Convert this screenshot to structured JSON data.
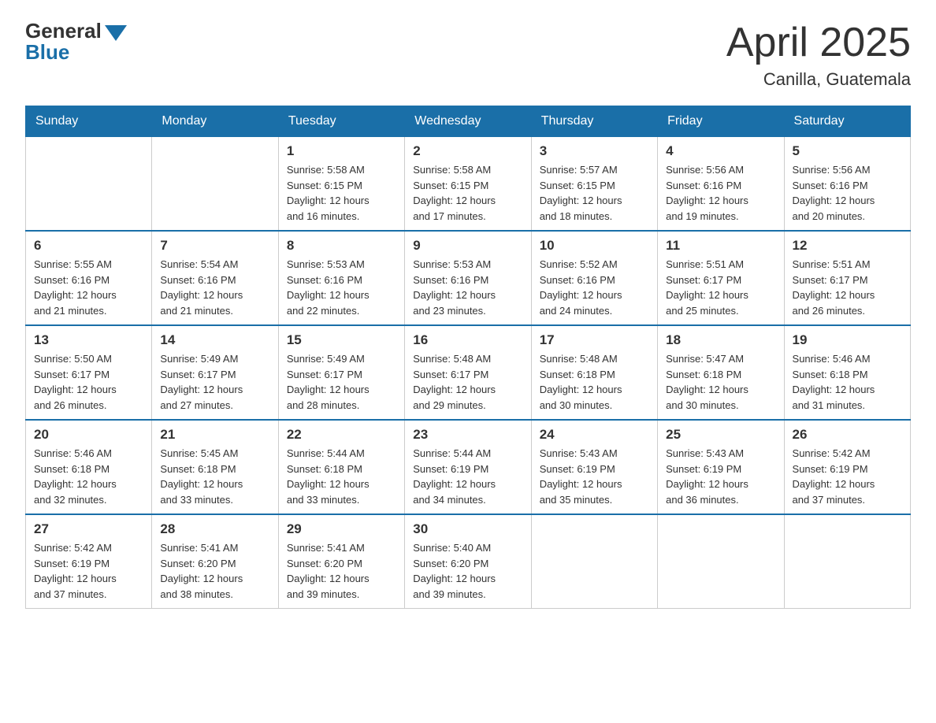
{
  "header": {
    "logo_general": "General",
    "logo_blue": "Blue",
    "month": "April 2025",
    "location": "Canilla, Guatemala"
  },
  "weekdays": [
    "Sunday",
    "Monday",
    "Tuesday",
    "Wednesday",
    "Thursday",
    "Friday",
    "Saturday"
  ],
  "weeks": [
    [
      {
        "day": "",
        "info": ""
      },
      {
        "day": "",
        "info": ""
      },
      {
        "day": "1",
        "info": "Sunrise: 5:58 AM\nSunset: 6:15 PM\nDaylight: 12 hours\nand 16 minutes."
      },
      {
        "day": "2",
        "info": "Sunrise: 5:58 AM\nSunset: 6:15 PM\nDaylight: 12 hours\nand 17 minutes."
      },
      {
        "day": "3",
        "info": "Sunrise: 5:57 AM\nSunset: 6:15 PM\nDaylight: 12 hours\nand 18 minutes."
      },
      {
        "day": "4",
        "info": "Sunrise: 5:56 AM\nSunset: 6:16 PM\nDaylight: 12 hours\nand 19 minutes."
      },
      {
        "day": "5",
        "info": "Sunrise: 5:56 AM\nSunset: 6:16 PM\nDaylight: 12 hours\nand 20 minutes."
      }
    ],
    [
      {
        "day": "6",
        "info": "Sunrise: 5:55 AM\nSunset: 6:16 PM\nDaylight: 12 hours\nand 21 minutes."
      },
      {
        "day": "7",
        "info": "Sunrise: 5:54 AM\nSunset: 6:16 PM\nDaylight: 12 hours\nand 21 minutes."
      },
      {
        "day": "8",
        "info": "Sunrise: 5:53 AM\nSunset: 6:16 PM\nDaylight: 12 hours\nand 22 minutes."
      },
      {
        "day": "9",
        "info": "Sunrise: 5:53 AM\nSunset: 6:16 PM\nDaylight: 12 hours\nand 23 minutes."
      },
      {
        "day": "10",
        "info": "Sunrise: 5:52 AM\nSunset: 6:16 PM\nDaylight: 12 hours\nand 24 minutes."
      },
      {
        "day": "11",
        "info": "Sunrise: 5:51 AM\nSunset: 6:17 PM\nDaylight: 12 hours\nand 25 minutes."
      },
      {
        "day": "12",
        "info": "Sunrise: 5:51 AM\nSunset: 6:17 PM\nDaylight: 12 hours\nand 26 minutes."
      }
    ],
    [
      {
        "day": "13",
        "info": "Sunrise: 5:50 AM\nSunset: 6:17 PM\nDaylight: 12 hours\nand 26 minutes."
      },
      {
        "day": "14",
        "info": "Sunrise: 5:49 AM\nSunset: 6:17 PM\nDaylight: 12 hours\nand 27 minutes."
      },
      {
        "day": "15",
        "info": "Sunrise: 5:49 AM\nSunset: 6:17 PM\nDaylight: 12 hours\nand 28 minutes."
      },
      {
        "day": "16",
        "info": "Sunrise: 5:48 AM\nSunset: 6:17 PM\nDaylight: 12 hours\nand 29 minutes."
      },
      {
        "day": "17",
        "info": "Sunrise: 5:48 AM\nSunset: 6:18 PM\nDaylight: 12 hours\nand 30 minutes."
      },
      {
        "day": "18",
        "info": "Sunrise: 5:47 AM\nSunset: 6:18 PM\nDaylight: 12 hours\nand 30 minutes."
      },
      {
        "day": "19",
        "info": "Sunrise: 5:46 AM\nSunset: 6:18 PM\nDaylight: 12 hours\nand 31 minutes."
      }
    ],
    [
      {
        "day": "20",
        "info": "Sunrise: 5:46 AM\nSunset: 6:18 PM\nDaylight: 12 hours\nand 32 minutes."
      },
      {
        "day": "21",
        "info": "Sunrise: 5:45 AM\nSunset: 6:18 PM\nDaylight: 12 hours\nand 33 minutes."
      },
      {
        "day": "22",
        "info": "Sunrise: 5:44 AM\nSunset: 6:18 PM\nDaylight: 12 hours\nand 33 minutes."
      },
      {
        "day": "23",
        "info": "Sunrise: 5:44 AM\nSunset: 6:19 PM\nDaylight: 12 hours\nand 34 minutes."
      },
      {
        "day": "24",
        "info": "Sunrise: 5:43 AM\nSunset: 6:19 PM\nDaylight: 12 hours\nand 35 minutes."
      },
      {
        "day": "25",
        "info": "Sunrise: 5:43 AM\nSunset: 6:19 PM\nDaylight: 12 hours\nand 36 minutes."
      },
      {
        "day": "26",
        "info": "Sunrise: 5:42 AM\nSunset: 6:19 PM\nDaylight: 12 hours\nand 37 minutes."
      }
    ],
    [
      {
        "day": "27",
        "info": "Sunrise: 5:42 AM\nSunset: 6:19 PM\nDaylight: 12 hours\nand 37 minutes."
      },
      {
        "day": "28",
        "info": "Sunrise: 5:41 AM\nSunset: 6:20 PM\nDaylight: 12 hours\nand 38 minutes."
      },
      {
        "day": "29",
        "info": "Sunrise: 5:41 AM\nSunset: 6:20 PM\nDaylight: 12 hours\nand 39 minutes."
      },
      {
        "day": "30",
        "info": "Sunrise: 5:40 AM\nSunset: 6:20 PM\nDaylight: 12 hours\nand 39 minutes."
      },
      {
        "day": "",
        "info": ""
      },
      {
        "day": "",
        "info": ""
      },
      {
        "day": "",
        "info": ""
      }
    ]
  ]
}
